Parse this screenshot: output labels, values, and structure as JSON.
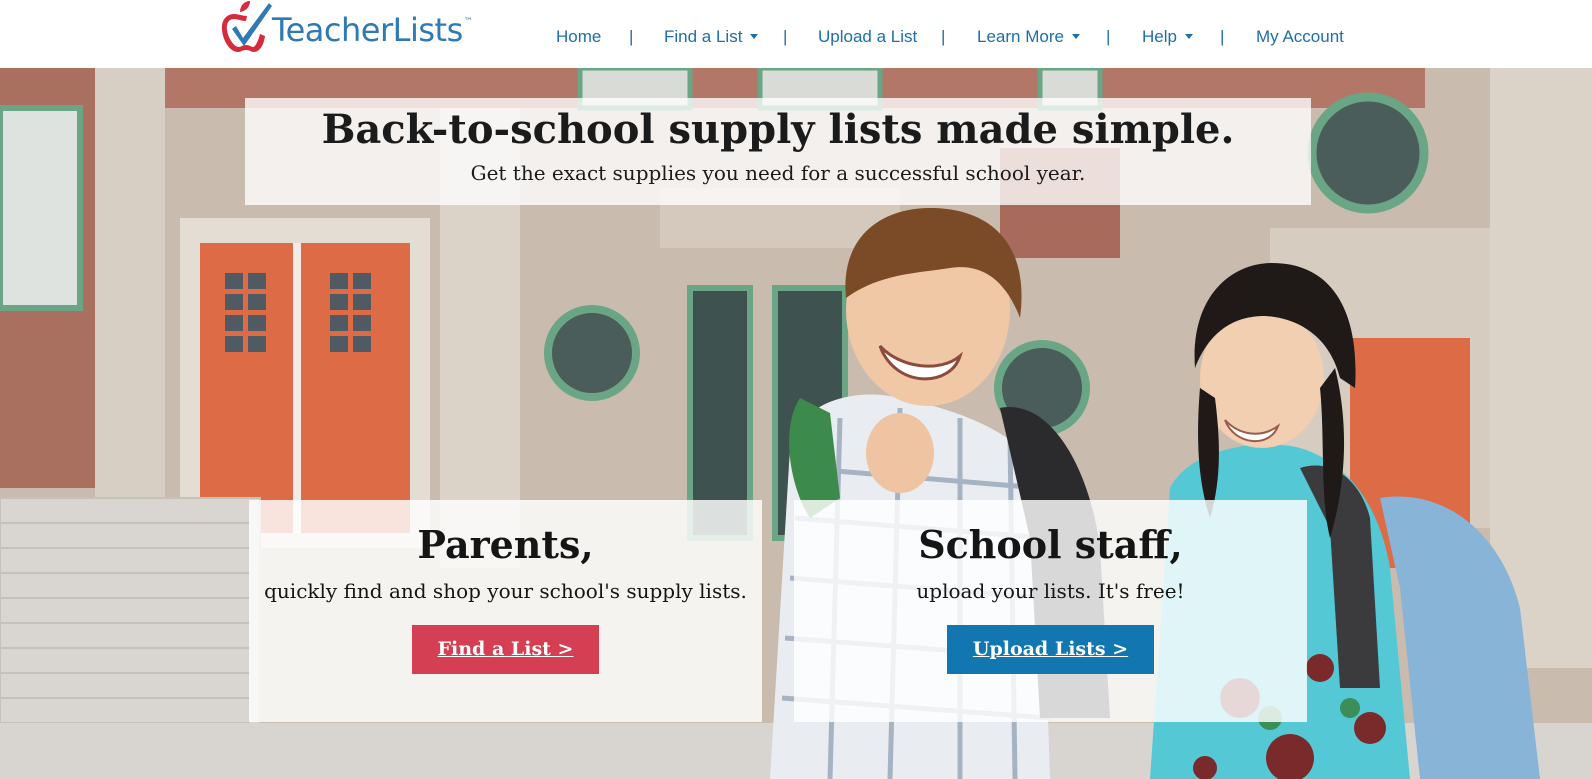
{
  "brand": {
    "name": "TeacherLists",
    "trademark": "™",
    "accent": "#2f79b5",
    "apple": "#d62b3a"
  },
  "nav": {
    "items": [
      {
        "label": "Home",
        "dropdown": false
      },
      {
        "label": "Find a List",
        "dropdown": true
      },
      {
        "label": "Upload a List",
        "dropdown": false
      },
      {
        "label": "Learn More",
        "dropdown": true
      },
      {
        "label": "Help",
        "dropdown": true
      },
      {
        "label": "My Account",
        "dropdown": false
      }
    ],
    "separator": "|"
  },
  "hero": {
    "headline": "Back-to-school supply lists made simple.",
    "subheadline": "Get the exact supplies you need for a successful school year."
  },
  "cards": {
    "parents": {
      "title": "Parents,",
      "text": "quickly find and shop your school's supply lists.",
      "cta": "Find a List >",
      "cta_color": "#d43f53"
    },
    "staff": {
      "title": "School staff,",
      "text": "upload your lists. It's free!",
      "cta": "Upload Lists >",
      "cta_color": "#1277b0"
    }
  }
}
